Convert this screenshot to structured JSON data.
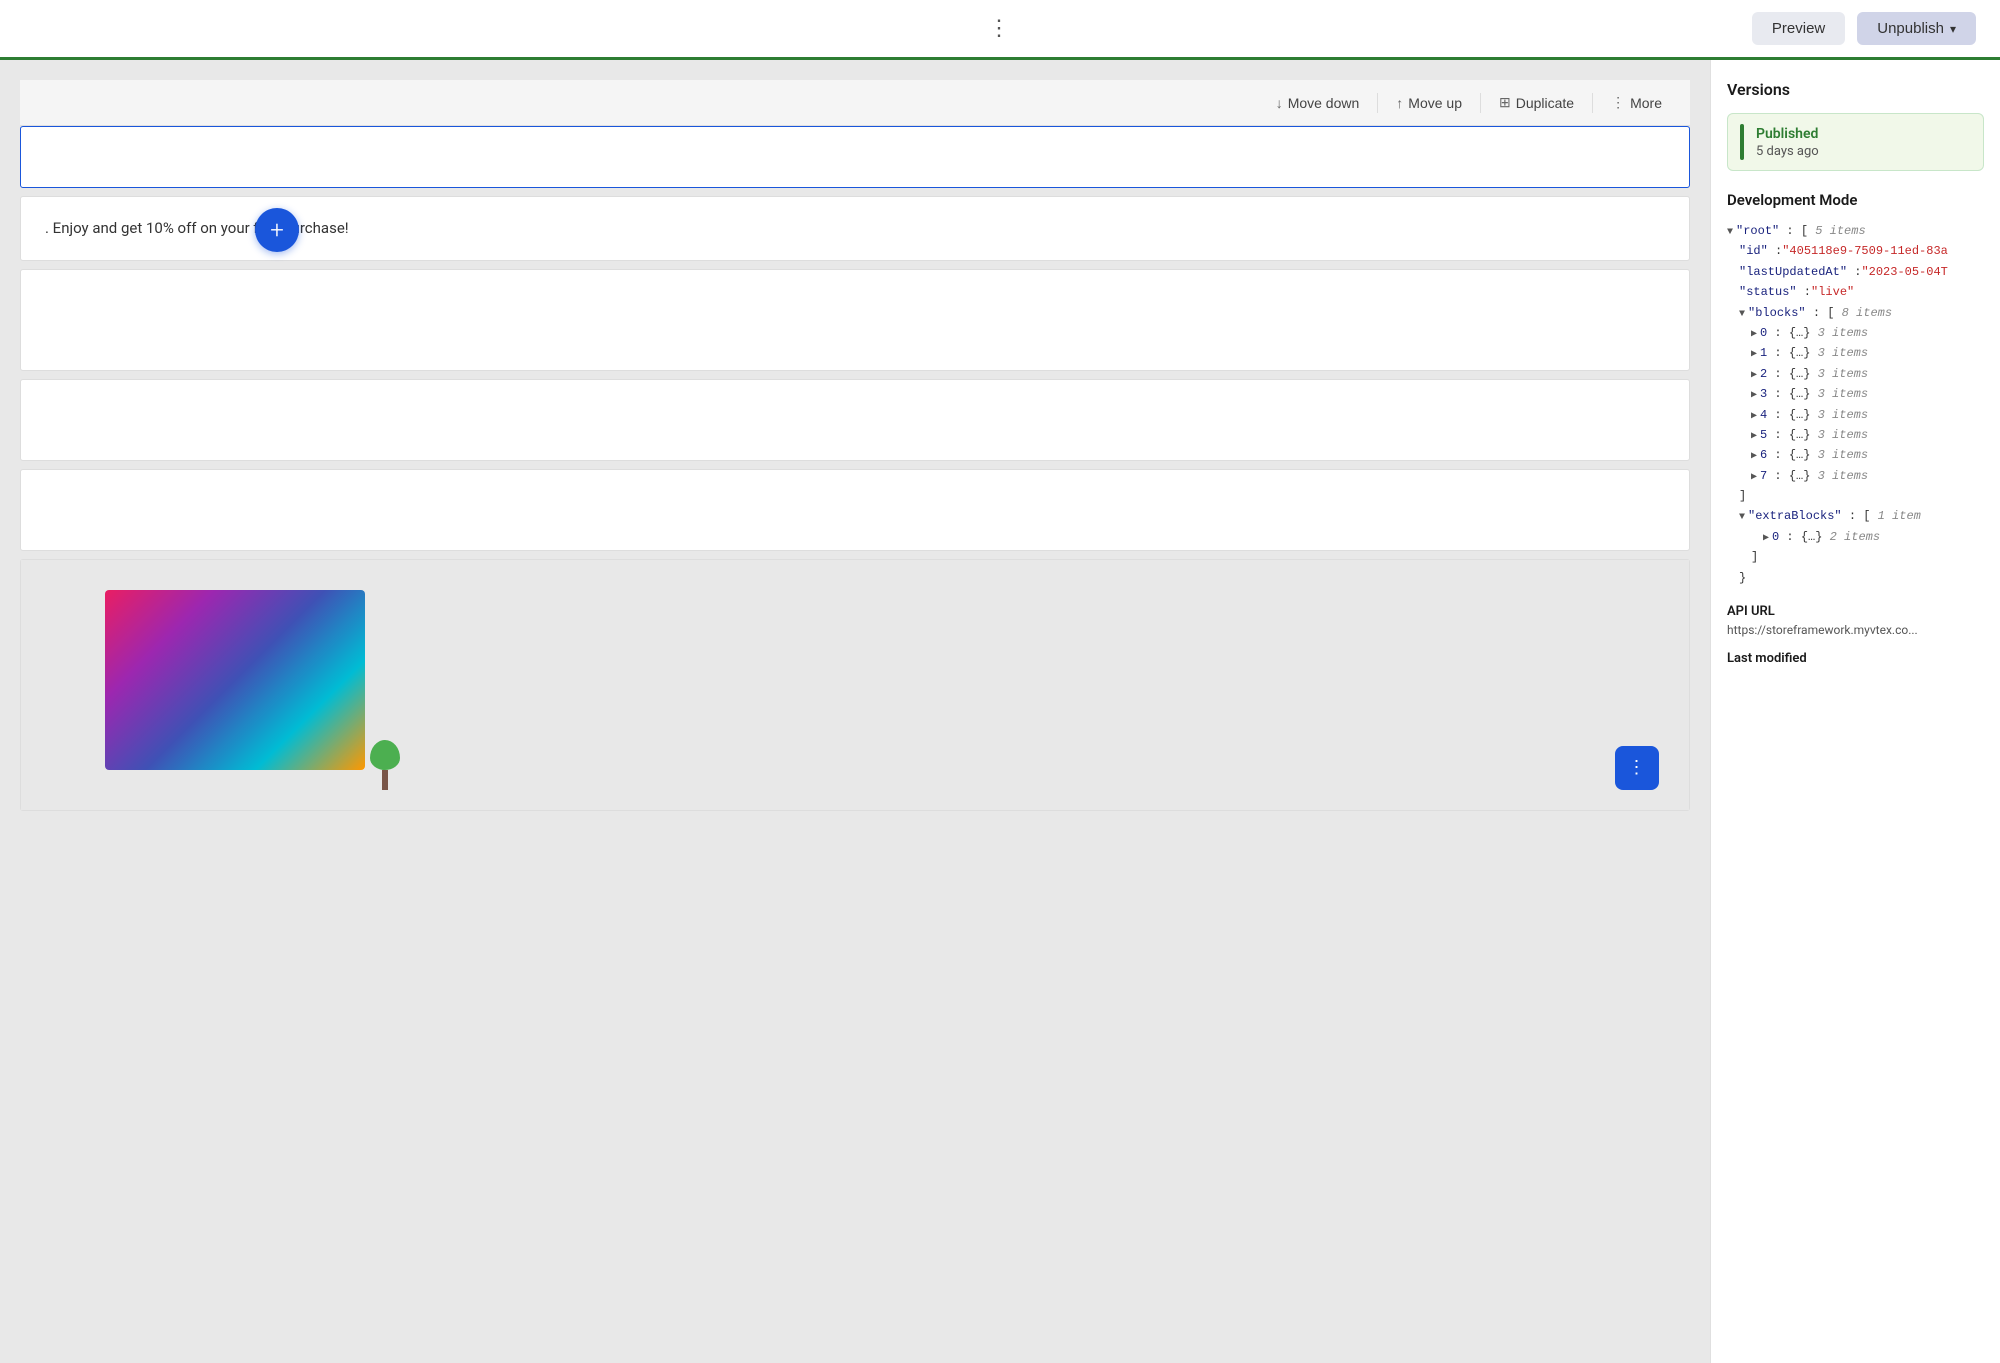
{
  "header": {
    "dots_label": "⋮",
    "preview_label": "Preview",
    "unpublish_label": "Unpublish",
    "unpublish_chevron": "▾"
  },
  "toolbar": {
    "move_down_label": "Move down",
    "move_up_label": "Move up",
    "duplicate_label": "Duplicate",
    "more_label": "More"
  },
  "add_block": {
    "label": "+"
  },
  "blocks": [
    {
      "type": "empty",
      "height": "short"
    },
    {
      "type": "text",
      "content": ". Enjoy and get 10% off on your first purchase!"
    },
    {
      "type": "empty",
      "height": "tall"
    },
    {
      "type": "empty",
      "height": "medium"
    },
    {
      "type": "empty",
      "height": "medium"
    },
    {
      "type": "image",
      "height": "large"
    }
  ],
  "right_panel": {
    "versions_title": "Versions",
    "version_status": "Published",
    "version_time": "5 days ago",
    "dev_mode_title": "Development Mode",
    "json": {
      "root_key": "\"root\"",
      "root_meta": "5 items",
      "id_key": "\"id\"",
      "id_value": "\"405118e9-7509-11ed-83a",
      "last_updated_key": "\"lastUpdatedAt\"",
      "last_updated_value": "\"2023-05-04T",
      "status_key": "\"status\"",
      "status_value": "\"live\"",
      "blocks_key": "\"blocks\"",
      "blocks_meta": "8 items",
      "block_items": [
        {
          "index": "0",
          "meta": "3 items"
        },
        {
          "index": "1",
          "meta": "3 items"
        },
        {
          "index": "2",
          "meta": "3 items"
        },
        {
          "index": "3",
          "meta": "3 items"
        },
        {
          "index": "4",
          "meta": "3 items"
        },
        {
          "index": "5",
          "meta": "3 items"
        },
        {
          "index": "6",
          "meta": "3 items"
        },
        {
          "index": "7",
          "meta": "3 items"
        }
      ],
      "extra_blocks_key": "\"extraBlocks\"",
      "extra_blocks_meta": "1 item",
      "extra_block_items": [
        {
          "index": "0",
          "meta": "2 items"
        }
      ]
    },
    "api_url_label": "API URL",
    "api_url_value": "https://storeframework.myvtex.co...",
    "last_modified_label": "Last modified"
  }
}
